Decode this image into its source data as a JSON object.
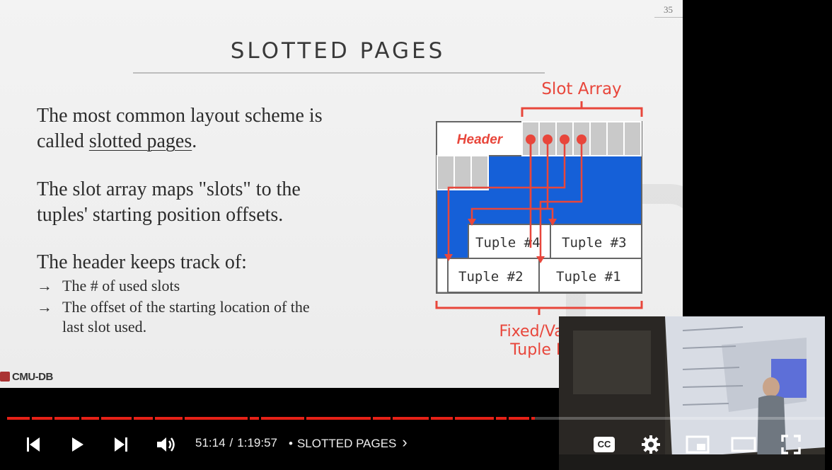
{
  "slide": {
    "page_number": "35",
    "title": "SLOTTED PAGES",
    "para1_a": "The most common layout scheme is",
    "para1_b_prefix": "called ",
    "para1_b_link": "slotted pages",
    "para1_b_suffix": ".",
    "para2_a": "The slot array maps \"slots\" to the",
    "para2_b": "tuples' starting position offsets.",
    "para3": "The header keeps track of:",
    "bullet_arrow": "→",
    "bullet1": "The # of used slots",
    "bullet2_a": "The offset of the starting location of the",
    "bullet2_b": "last slot used.",
    "logo": "CMU-DB"
  },
  "diagram": {
    "slot_array_label": "Slot Array",
    "header_label": "Header",
    "tuple4": "Tuple #4",
    "tuple3": "Tuple #3",
    "tuple2": "Tuple #2",
    "tuple1": "Tuple #1",
    "bottom_label_1": "Fixed/Var-l",
    "bottom_label_2": "Tuple D",
    "colors": {
      "accent": "#e8463b",
      "free_space": "#1560d8",
      "slot": "#c9c9c9"
    }
  },
  "player": {
    "progress_fraction": 0.645,
    "current_time": "51:14",
    "separator": "/",
    "duration": "1:19:57",
    "chapter_dot": "•",
    "chapter_title": "SLOTTED PAGES",
    "chapter_chevron": "›",
    "cc_label": "CC",
    "colors": {
      "progress": "#e62117"
    }
  }
}
